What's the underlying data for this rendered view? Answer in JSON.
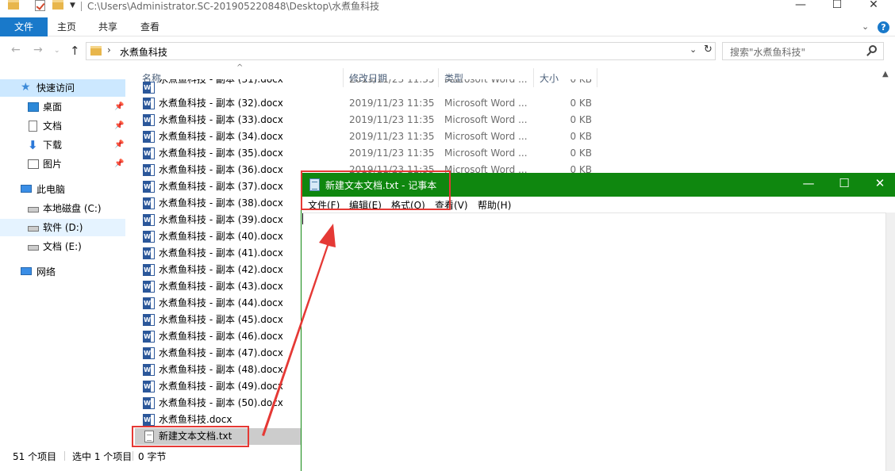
{
  "explorer": {
    "title_path": "C:\\Users\\Administrator.SC-201905220848\\Desktop\\水煮鱼科技",
    "window_controls": {
      "minimize": "—",
      "maximize": "☐",
      "close": "✕"
    },
    "ribbon": {
      "file": "文件",
      "tabs": [
        "主页",
        "共享",
        "查看"
      ],
      "expand": "⌄",
      "help": "?"
    },
    "address": {
      "back": "←",
      "forward": "→",
      "up": "↑",
      "separator": "›",
      "path": "水煮鱼科技",
      "dropdown": "⌄",
      "refresh": "↻"
    },
    "search": {
      "placeholder": "搜索\"水煮鱼科技\""
    },
    "nav": [
      {
        "label": "快速访问",
        "icon": "star-icon",
        "pinned": false
      },
      {
        "label": "桌面",
        "icon": "desktop-icon",
        "pinned": true
      },
      {
        "label": "文档",
        "icon": "documents-icon",
        "pinned": true
      },
      {
        "label": "下载",
        "icon": "download-icon",
        "pinned": true
      },
      {
        "label": "图片",
        "icon": "pictures-icon",
        "pinned": true
      },
      {
        "label": "此电脑",
        "icon": "computer-icon",
        "pinned": false
      },
      {
        "label": "本地磁盘 (C:)",
        "icon": "drive-icon",
        "pinned": false
      },
      {
        "label": "软件 (D:)",
        "icon": "drive-icon",
        "pinned": false
      },
      {
        "label": "文档 (E:)",
        "icon": "drive-icon",
        "pinned": false
      },
      {
        "label": "网络",
        "icon": "network-icon",
        "pinned": false
      }
    ],
    "pin_glyph": "📌",
    "columns": {
      "name": "名称",
      "date": "修改日期",
      "type": "类型",
      "size": "大小"
    },
    "sort_indicator": "^",
    "files": [
      {
        "name": "水煮鱼科技 - 副本 (31).docx",
        "date": "2019/11/23 11:35",
        "type": "Microsoft Word ...",
        "size": "0 KB",
        "kind": "word"
      },
      {
        "name": "水煮鱼科技 - 副本 (32).docx",
        "date": "2019/11/23 11:35",
        "type": "Microsoft Word ...",
        "size": "0 KB",
        "kind": "word"
      },
      {
        "name": "水煮鱼科技 - 副本 (33).docx",
        "date": "2019/11/23 11:35",
        "type": "Microsoft Word ...",
        "size": "0 KB",
        "kind": "word"
      },
      {
        "name": "水煮鱼科技 - 副本 (34).docx",
        "date": "2019/11/23 11:35",
        "type": "Microsoft Word ...",
        "size": "0 KB",
        "kind": "word"
      },
      {
        "name": "水煮鱼科技 - 副本 (35).docx",
        "date": "2019/11/23 11:35",
        "type": "Microsoft Word ...",
        "size": "0 KB",
        "kind": "word"
      },
      {
        "name": "水煮鱼科技 - 副本 (36).docx",
        "date": "2019/11/23 11:35",
        "type": "Microsoft Word ...",
        "size": "0 KB",
        "kind": "word"
      },
      {
        "name": "水煮鱼科技 - 副本 (37).docx",
        "date": "",
        "type": "",
        "size": "",
        "kind": "word"
      },
      {
        "name": "水煮鱼科技 - 副本 (38).docx",
        "date": "",
        "type": "",
        "size": "",
        "kind": "word"
      },
      {
        "name": "水煮鱼科技 - 副本 (39).docx",
        "date": "",
        "type": "",
        "size": "",
        "kind": "word"
      },
      {
        "name": "水煮鱼科技 - 副本 (40).docx",
        "date": "",
        "type": "",
        "size": "",
        "kind": "word"
      },
      {
        "name": "水煮鱼科技 - 副本 (41).docx",
        "date": "",
        "type": "",
        "size": "",
        "kind": "word"
      },
      {
        "name": "水煮鱼科技 - 副本 (42).docx",
        "date": "",
        "type": "",
        "size": "",
        "kind": "word"
      },
      {
        "name": "水煮鱼科技 - 副本 (43).docx",
        "date": "",
        "type": "",
        "size": "",
        "kind": "word"
      },
      {
        "name": "水煮鱼科技 - 副本 (44).docx",
        "date": "",
        "type": "",
        "size": "",
        "kind": "word"
      },
      {
        "name": "水煮鱼科技 - 副本 (45).docx",
        "date": "",
        "type": "",
        "size": "",
        "kind": "word"
      },
      {
        "name": "水煮鱼科技 - 副本 (46).docx",
        "date": "",
        "type": "",
        "size": "",
        "kind": "word"
      },
      {
        "name": "水煮鱼科技 - 副本 (47).docx",
        "date": "",
        "type": "",
        "size": "",
        "kind": "word"
      },
      {
        "name": "水煮鱼科技 - 副本 (48).docx",
        "date": "",
        "type": "",
        "size": "",
        "kind": "word"
      },
      {
        "name": "水煮鱼科技 - 副本 (49).docx",
        "date": "",
        "type": "",
        "size": "",
        "kind": "word"
      },
      {
        "name": "水煮鱼科技 - 副本 (50).docx",
        "date": "",
        "type": "",
        "size": "",
        "kind": "word"
      },
      {
        "name": "水煮鱼科技.docx",
        "date": "",
        "type": "",
        "size": "",
        "kind": "word"
      },
      {
        "name": "新建文本文档.txt",
        "date": "",
        "type": "",
        "size": "",
        "kind": "txt",
        "selected": true
      }
    ],
    "status": {
      "count": "51 个项目",
      "selected": "选中 1 个项目",
      "size": "0 字节"
    },
    "scroll_up": "▲"
  },
  "notepad": {
    "title": "新建文本文档.txt - 记事本",
    "controls": {
      "minimize": "—",
      "maximize": "☐",
      "close": "✕"
    },
    "menu": [
      "文件(F)",
      "编辑(E)",
      "格式(O)",
      "查看(V)",
      "帮助(H)"
    ],
    "content": ""
  },
  "annotation_color": "#e53935",
  "accent_color": "#1979ca",
  "notepad_titlebar_color": "#0f870f"
}
